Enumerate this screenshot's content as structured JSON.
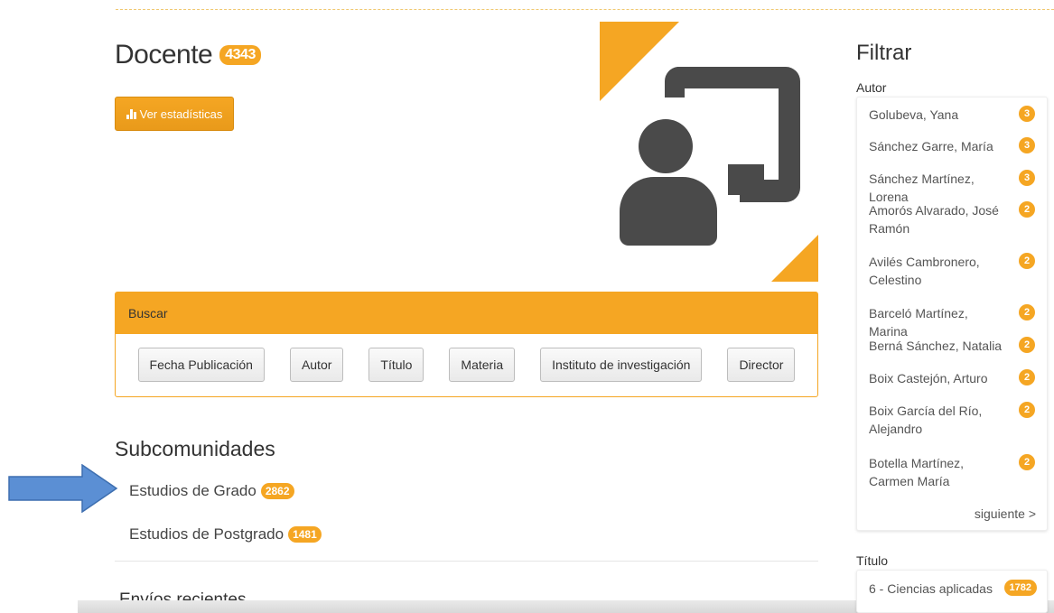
{
  "page": {
    "title": "Docente",
    "count": "4343",
    "stats_button": "Ver estadísticas"
  },
  "search": {
    "header": "Buscar",
    "buttons": [
      "Fecha Publicación",
      "Autor",
      "Título",
      "Materia",
      "Instituto de investigación",
      "Director"
    ]
  },
  "subcommunities": {
    "title": "Subcomunidades",
    "items": [
      {
        "label": "Estudios de Grado",
        "count": "2862"
      },
      {
        "label": "Estudios de Postgrado",
        "count": "1481"
      }
    ]
  },
  "recent": {
    "title": "Envíos recientes"
  },
  "sidebar": {
    "title": "Filtrar",
    "author_label": "Autor",
    "authors": [
      {
        "name": "Golubeva, Yana",
        "count": "3"
      },
      {
        "name": "Sánchez Garre, María",
        "count": "3"
      },
      {
        "name": "Sánchez Martínez, Lorena",
        "count": "3"
      },
      {
        "name": "Amorós Alvarado, José Ramón",
        "count": "2"
      },
      {
        "name": "Avilés Cambronero, Celestino",
        "count": "2"
      },
      {
        "name": "Barceló Martínez, Marina",
        "count": "2"
      },
      {
        "name": "Berná Sánchez, Natalia",
        "count": "2"
      },
      {
        "name": "Boix Castejón, Arturo",
        "count": "2"
      },
      {
        "name": "Boix García del Río, Alejandro",
        "count": "2"
      },
      {
        "name": "Botella Martínez, Carmen María",
        "count": "2"
      }
    ],
    "next_link": "siguiente >",
    "title_label": "Título",
    "titles": [
      {
        "name": "6 - Ciencias aplicadas",
        "count": "1782"
      }
    ]
  },
  "colors": {
    "accent": "#f5a623",
    "icon_dark": "#4a4a4a",
    "arrow": "#5b8fd4"
  },
  "icons": {
    "stats": "bar-chart-icon",
    "logo": "teacher-board-icon",
    "pointer": "right-arrow-icon"
  }
}
